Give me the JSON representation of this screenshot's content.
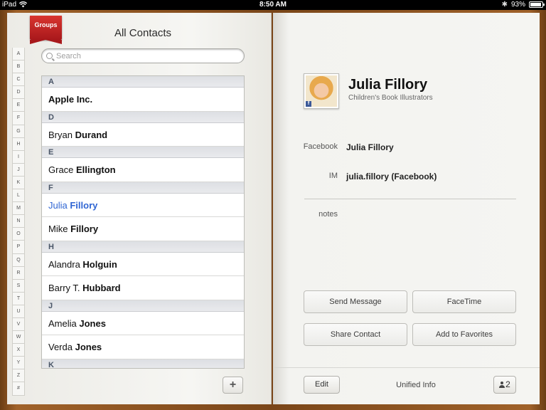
{
  "status_bar": {
    "device": "iPad",
    "time": "8:50 AM",
    "battery": "93%",
    "battery_level": 0.93
  },
  "left_page": {
    "groups_label": "Groups",
    "title": "All Contacts",
    "search": {
      "placeholder": "Search",
      "value": ""
    },
    "index_letters": [
      "A",
      "B",
      "C",
      "D",
      "E",
      "F",
      "G",
      "H",
      "I",
      "J",
      "K",
      "L",
      "M",
      "N",
      "O",
      "P",
      "Q",
      "R",
      "S",
      "T",
      "U",
      "V",
      "W",
      "X",
      "Y",
      "Z",
      "#"
    ],
    "list": [
      {
        "type": "header",
        "text": "A"
      },
      {
        "type": "contact",
        "first": "",
        "last": "Apple Inc.",
        "company": true
      },
      {
        "type": "header",
        "text": "D"
      },
      {
        "type": "contact",
        "first": "Bryan ",
        "last": "Durand"
      },
      {
        "type": "header",
        "text": "E"
      },
      {
        "type": "contact",
        "first": "Grace ",
        "last": "Ellington"
      },
      {
        "type": "header",
        "text": "F"
      },
      {
        "type": "contact",
        "first": "Julia ",
        "last": "Fillory",
        "selected": true
      },
      {
        "type": "contact",
        "first": "Mike ",
        "last": "Fillory"
      },
      {
        "type": "header",
        "text": "H"
      },
      {
        "type": "contact",
        "first": "Alandra ",
        "last": "Holguin"
      },
      {
        "type": "contact",
        "first": "Barry T. ",
        "last": "Hubbard"
      },
      {
        "type": "header",
        "text": "J"
      },
      {
        "type": "contact",
        "first": "Amelia ",
        "last": "Jones"
      },
      {
        "type": "contact",
        "first": "Verda ",
        "last": "Jones"
      },
      {
        "type": "header",
        "text": "K"
      }
    ],
    "add_label": "+"
  },
  "detail": {
    "name": "Julia Fillory",
    "subtitle": "Children's Book Illustrators",
    "avatar_badge": "f",
    "fields": {
      "facebook_label": "Facebook",
      "facebook_value": "Julia Fillory",
      "im_label": "IM",
      "im_value": "julia.fillory (Facebook)"
    },
    "notes_label": "notes",
    "actions": {
      "send_message": "Send Message",
      "facetime": "FaceTime",
      "share_contact": "Share Contact",
      "add_to_favorites": "Add to Favorites"
    },
    "footer": {
      "edit_label": "Edit",
      "unified_info": "Unified Info",
      "linked_count": "2"
    }
  },
  "colors": {
    "selected_text": "#2f65d3",
    "section_header_text": "#4a5668",
    "ribbon": "#c0262a"
  }
}
